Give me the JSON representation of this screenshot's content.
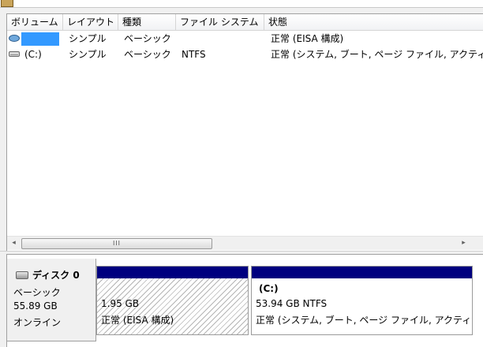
{
  "columns": [
    {
      "label": "ボリューム"
    },
    {
      "label": "レイアウト"
    },
    {
      "label": "種類"
    },
    {
      "label": "ファイル システム"
    },
    {
      "label": "状態"
    }
  ],
  "volumes": [
    {
      "name": "",
      "layout": "シンプル",
      "type": "ベーシック",
      "fs": "",
      "status": "正常 (EISA 構成)",
      "icon": "volume-blue-icon"
    },
    {
      "name": "(C:)",
      "layout": "シンプル",
      "type": "ベーシック",
      "fs": "NTFS",
      "status": "正常 (システム, ブート, ページ ファイル, アクティブ",
      "icon": "volume-drive-icon"
    }
  ],
  "scrollbar": {
    "left_arrow": "◂",
    "right_arrow": "▸",
    "grip": "III"
  },
  "disk": {
    "title": "ディスク 0",
    "kind": "ベーシック",
    "size": "55.89 GB",
    "state": "オンライン",
    "icon": "disk-icon"
  },
  "partitions": [
    {
      "name": "",
      "size_fs": "1.95 GB",
      "status": "正常 (EISA 構成)"
    },
    {
      "name": "(C:)",
      "size_fs": "53.94 GB NTFS",
      "status": "正常 (システム, ブート, ページ ファイル, アクティブ"
    }
  ],
  "colors": {
    "partition_header": "#00007f",
    "selection": "#3399ff"
  }
}
